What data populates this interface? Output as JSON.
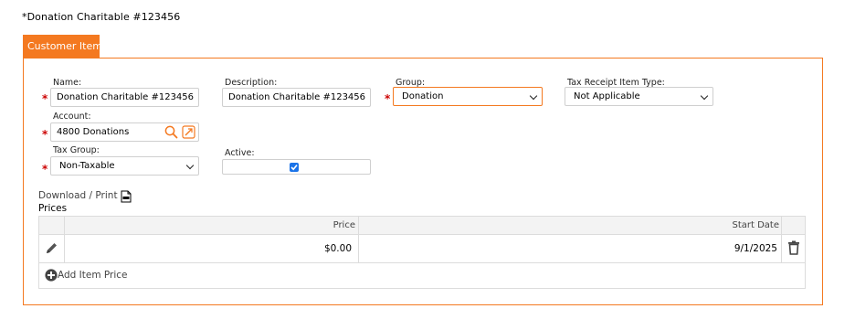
{
  "page": {
    "title": "*Donation Charitable #123456"
  },
  "tabs": [
    {
      "label": "Customer Item"
    }
  ],
  "form": {
    "name": {
      "label": "Name:",
      "value": "Donation Charitable #123456",
      "required": true
    },
    "description": {
      "label": "Description:",
      "value": "Donation Charitable #123456"
    },
    "group": {
      "label": "Group:",
      "value": "Donation",
      "required": true
    },
    "tax_receipt_item_type": {
      "label": "Tax Receipt Item Type:",
      "value": "Not Applicable"
    },
    "account": {
      "label": "Account:",
      "value": "4800  Donations",
      "required": true
    },
    "tax_group": {
      "label": "Tax Group:",
      "value": "Non-Taxable",
      "required": true
    },
    "active": {
      "label": "Active:",
      "checked": true
    },
    "required_marker": "*"
  },
  "prices": {
    "download_label": "Download / Print",
    "title": "Prices",
    "columns": [
      "Price",
      "Start Date"
    ],
    "rows": [
      {
        "price": "$0.00",
        "start_date": "9/1/2025"
      }
    ],
    "add_label": "Add Item Price"
  },
  "colors": {
    "accent": "#f47920",
    "required": "#cc0000",
    "checkbox": "#1a73e8"
  },
  "icons": [
    "search-icon",
    "edit-link-icon",
    "csv-file-icon",
    "pencil-icon",
    "trash-icon",
    "plus-circle-icon",
    "chevron-down-icon"
  ]
}
